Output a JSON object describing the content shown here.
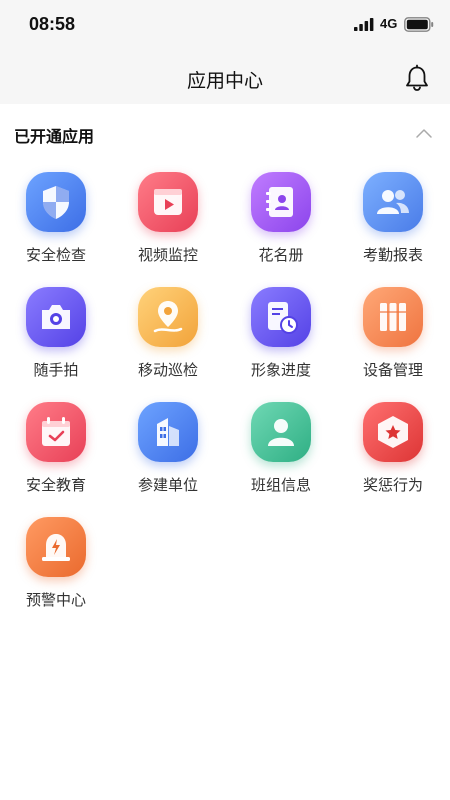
{
  "status_bar": {
    "time": "08:58",
    "network": "4G"
  },
  "header": {
    "title": "应用中心"
  },
  "section": {
    "title": "已开通应用"
  },
  "apps": [
    {
      "label": "安全检查",
      "icon": "shield-icon",
      "color": "#4f86f0"
    },
    {
      "label": "视频监控",
      "icon": "video-icon",
      "color": "#f0566a"
    },
    {
      "label": "花名册",
      "icon": "contacts-book-icon",
      "color": "#a35af0"
    },
    {
      "label": "考勤报表",
      "icon": "people-icon",
      "color": "#4f86f0"
    },
    {
      "label": "随手拍",
      "icon": "camera-icon",
      "color": "#6a5cf0"
    },
    {
      "label": "移动巡检",
      "icon": "location-icon",
      "color": "#f5b540"
    },
    {
      "label": "形象进度",
      "icon": "progress-clock-icon",
      "color": "#6a5cf0"
    },
    {
      "label": "设备管理",
      "icon": "binders-icon",
      "color": "#f58a56"
    },
    {
      "label": "安全教育",
      "icon": "calendar-check-icon",
      "color": "#f0566a"
    },
    {
      "label": "参建单位",
      "icon": "building-icon",
      "color": "#4f86f0"
    },
    {
      "label": "班组信息",
      "icon": "person-icon",
      "color": "#3fbf94"
    },
    {
      "label": "奖惩行为",
      "icon": "badge-star-icon",
      "color": "#ee4a4a"
    },
    {
      "label": "预警中心",
      "icon": "alarm-light-icon",
      "color": "#f58a46"
    }
  ]
}
